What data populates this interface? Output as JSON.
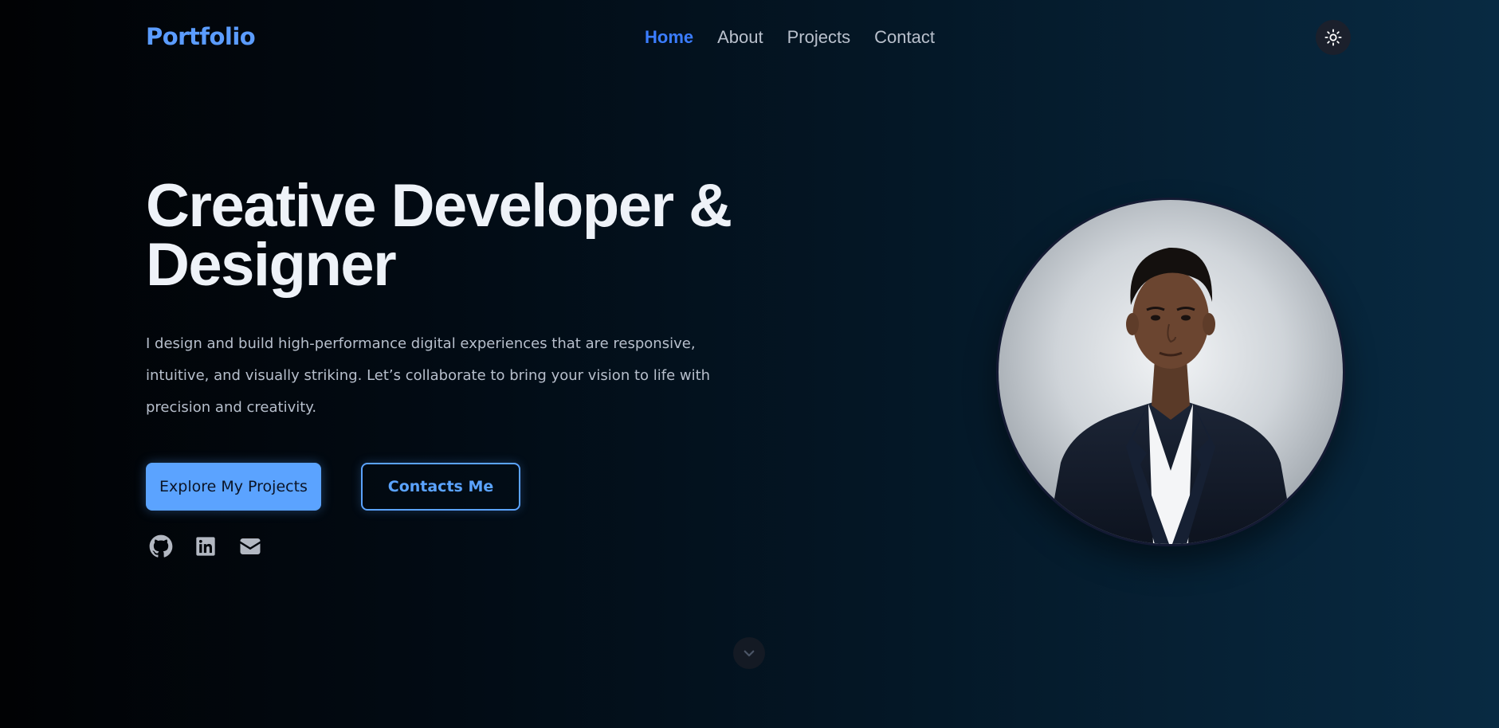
{
  "header": {
    "logo": "Portfolio",
    "nav": [
      {
        "label": "Home",
        "active": true
      },
      {
        "label": "About",
        "active": false
      },
      {
        "label": "Projects",
        "active": false
      },
      {
        "label": "Contact",
        "active": false
      }
    ],
    "theme_toggle_icon": "sun-icon"
  },
  "hero": {
    "title_line1": "Creative Developer &",
    "title_line2": "Designer",
    "description": "I design and build high-performance digital experiences that are responsive, intuitive, and visually striking. Let’s collaborate to bring your vision to life with precision and creativity.",
    "primary_button": "Explore My Projects",
    "secondary_button": "Contacts Me",
    "socials": [
      "github-icon",
      "linkedin-icon",
      "mail-icon"
    ],
    "portrait_icon": "profile-photo",
    "scroll_icon": "chevron-down-icon"
  },
  "colors": {
    "accent": "#5ba3ff",
    "nav_active": "#3b7dff",
    "nav_inactive": "#b9c0cc",
    "logo": "#5b9cff",
    "heading": "#eef2f8",
    "body_text": "#b7bfcc",
    "button_text_dark": "#0b1426",
    "social_icon": "#b3b8c2",
    "toggle_bg": "#1b202c",
    "scroll_bg": "#141a24"
  }
}
